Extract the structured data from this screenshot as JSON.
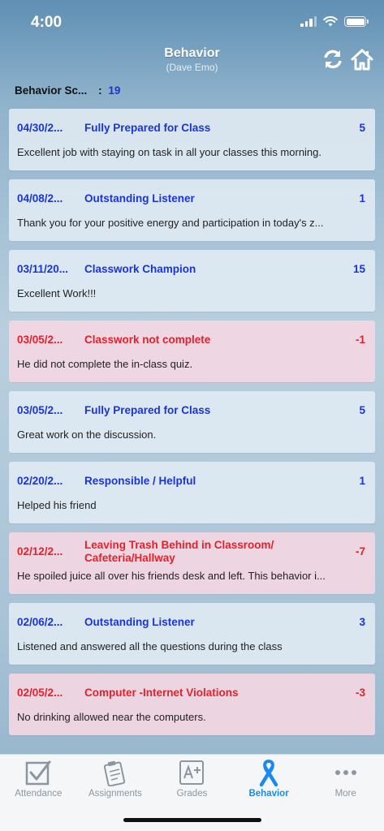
{
  "status": {
    "time": "4:00"
  },
  "header": {
    "title": "Behavior",
    "subtitle": "(Dave Emo)",
    "icons": [
      "refresh-icon",
      "home-icon"
    ]
  },
  "score": {
    "label": "Behavior Sc...",
    "separator": ":",
    "value": "19"
  },
  "entries": [
    {
      "date": "04/30/2...",
      "title": "Fully Prepared for Class",
      "points": "5",
      "comment": "Excellent job with staying on task in all your classes this morning.",
      "type": "positive"
    },
    {
      "date": "04/08/2...",
      "title": "Outstanding Listener",
      "points": "1",
      "comment": "Thank you for your positive energy and participation in today's z...",
      "type": "positive"
    },
    {
      "date": "03/11/20...",
      "title": "Classwork Champion",
      "points": "15",
      "comment": "Excellent Work!!!",
      "type": "positive"
    },
    {
      "date": "03/05/2...",
      "title": "Classwork not complete",
      "points": "-1",
      "comment": "He did not complete the in-class quiz.",
      "type": "negative"
    },
    {
      "date": "03/05/2...",
      "title": "Fully Prepared for Class",
      "points": "5",
      "comment": "Great work on the discussion.",
      "type": "positive"
    },
    {
      "date": "02/20/2...",
      "title": "Responsible / Helpful",
      "points": "1",
      "comment": "Helped his friend",
      "type": "positive"
    },
    {
      "date": "02/12/2...",
      "title": "Leaving Trash Behind in Classroom/ Cafeteria/Hallway",
      "points": "-7",
      "comment": "He spoiled juice all over his friends desk and left. This behavior i...",
      "type": "negative"
    },
    {
      "date": "02/06/2...",
      "title": "Outstanding Listener",
      "points": "3",
      "comment": "Listened and answered all the questions during the class",
      "type": "positive"
    },
    {
      "date": "02/05/2...",
      "title": "Computer -Internet Violations",
      "points": "-3",
      "comment": "No drinking allowed near the computers.",
      "type": "negative"
    }
  ],
  "colors": {
    "positive": "#1a35d6",
    "negative": "#e8202a",
    "active_tab": "#1a8af0"
  },
  "tabs": [
    {
      "label": "Attendance",
      "icon": "checkbox-icon"
    },
    {
      "label": "Assignments",
      "icon": "clipboard-icon"
    },
    {
      "label": "Grades",
      "icon": "grade-a-plus-icon"
    },
    {
      "label": "Behavior",
      "icon": "ribbon-icon",
      "active": true
    },
    {
      "label": "More",
      "icon": "more-dots-icon"
    }
  ]
}
